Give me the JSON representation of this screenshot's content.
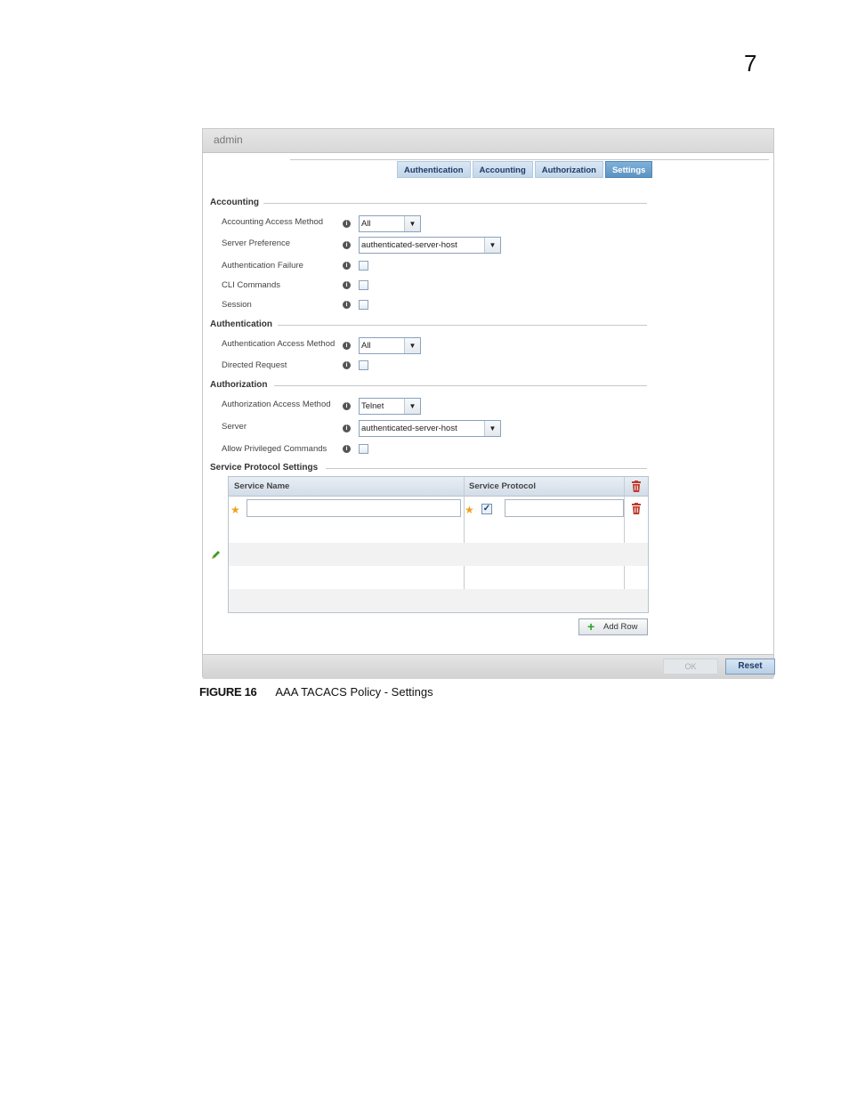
{
  "page": {
    "chapter_number": "7"
  },
  "window": {
    "title": "admin"
  },
  "tabs": [
    {
      "label": "Authentication",
      "active": false
    },
    {
      "label": "Accounting",
      "active": false
    },
    {
      "label": "Authorization",
      "active": false
    },
    {
      "label": "Settings",
      "active": true
    }
  ],
  "accounting": {
    "title": "Accounting",
    "access_method": {
      "label": "Accounting Access Method",
      "value": "All"
    },
    "server_preference": {
      "label": "Server Preference",
      "value": "authenticated-server-host"
    },
    "authentication_failure": {
      "label": "Authentication Failure",
      "checked": false
    },
    "cli_commands": {
      "label": "CLI Commands",
      "checked": false
    },
    "session": {
      "label": "Session",
      "checked": false
    }
  },
  "authentication": {
    "title": "Authentication",
    "access_method": {
      "label": "Authentication Access Method",
      "value": "All"
    },
    "directed_request": {
      "label": "Directed Request",
      "checked": false
    }
  },
  "authorization": {
    "title": "Authorization",
    "access_method": {
      "label": "Authorization Access Method",
      "value": "Telnet"
    },
    "server": {
      "label": "Server",
      "value": "authenticated-server-host"
    },
    "allow_privileged": {
      "label": "Allow Privileged Commands",
      "checked": false
    }
  },
  "service_protocol": {
    "title": "Service Protocol Settings",
    "columns": [
      "Service Name",
      "Service Protocol"
    ],
    "rows": [
      {
        "service_name": "",
        "protocol_checked": true,
        "service_protocol": ""
      }
    ],
    "add_row_label": "Add Row"
  },
  "footer": {
    "ok_label": "OK",
    "reset_label": "Reset"
  },
  "caption": {
    "figure_label": "FIGURE 16",
    "text": "AAA TACACS Policy - Settings"
  },
  "colors": {
    "accent_tab": "#5b93c2",
    "star": "#f0a020",
    "trash": "#c0392b",
    "add": "#27a327"
  },
  "icons": [
    "info-icon",
    "star-icon",
    "trash-icon",
    "pencil-icon",
    "plus-icon",
    "chevron-down-icon"
  ]
}
